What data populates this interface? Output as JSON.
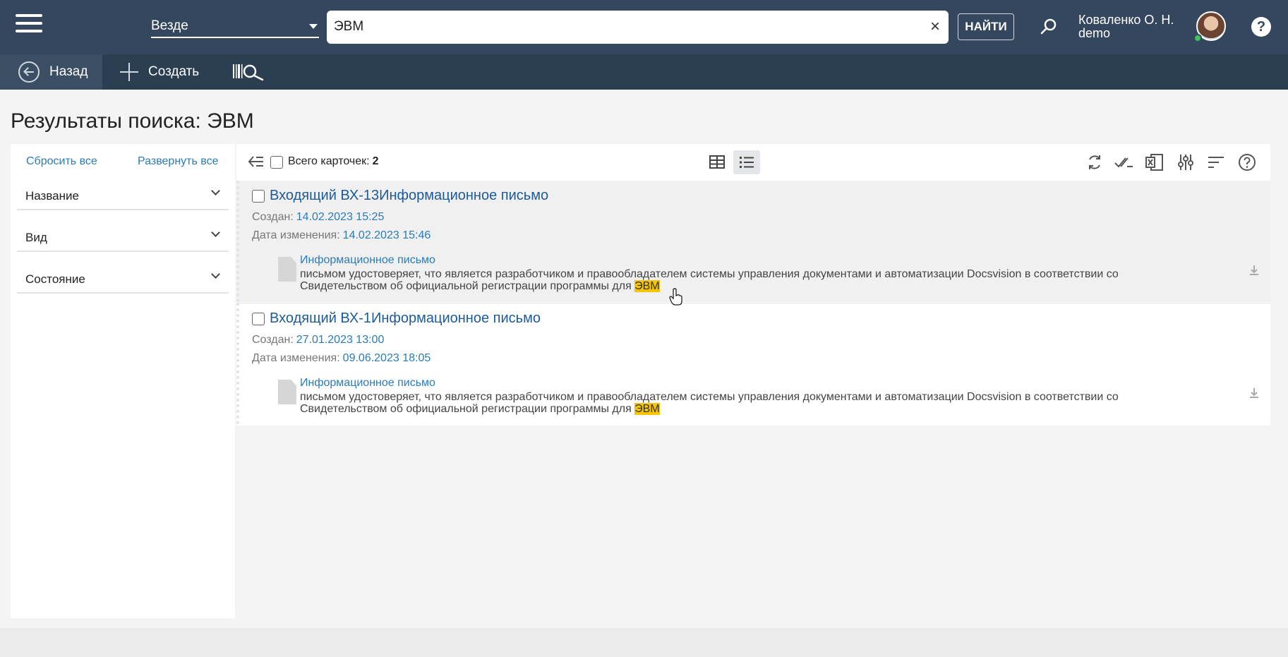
{
  "header": {
    "scope": "Везде",
    "search_value": "ЭВМ",
    "clear_glyph": "×",
    "find_label": "НАЙТИ",
    "user_name": "Коваленко О. Н.",
    "user_login": "demo",
    "help_glyph": "?"
  },
  "toolbar": {
    "back_label": "Назад",
    "create_label": "Создать"
  },
  "page": {
    "title": "Результаты поиска: ЭВМ"
  },
  "filters": {
    "reset_all": "Сбросить все",
    "expand_all": "Развернуть все",
    "items": [
      {
        "label": "Название"
      },
      {
        "label": "Вид"
      },
      {
        "label": "Состояние"
      }
    ]
  },
  "results": {
    "count_label": "Всего карточек:",
    "count_value": "2",
    "created_label": "Создан:",
    "modified_label": "Дата изменения:",
    "items": [
      {
        "title": "Входящий ВХ-13Информационное письмо",
        "created": "14.02.2023 15:25",
        "modified": "14.02.2023 15:46",
        "file_title": "Информационное письмо",
        "snippet_line1": "письмом удостоверяет, что является разработчиком и правообладателем системы управления документами и автоматизации Docsvision в соответствии со",
        "snippet_line2": "Свидетельством об официальной регистрации программы для ",
        "highlight": "ЭВМ"
      },
      {
        "title": "Входящий ВХ-1Информационное письмо",
        "created": "27.01.2023 13:00",
        "modified": "09.06.2023 18:05",
        "file_title": "Информационное письмо",
        "snippet_line1": "письмом удостоверяет, что является разработчиком и правообладателем системы управления документами и автоматизации Docsvision в соответствии со",
        "snippet_line2": "Свидетельством об официальной регистрации программы для ",
        "highlight": "ЭВМ"
      }
    ]
  },
  "colors": {
    "header_bg": "#34475e",
    "toolbar_bg": "#2b3e52",
    "link": "#2b7bb9",
    "highlight": "#f7c500"
  }
}
